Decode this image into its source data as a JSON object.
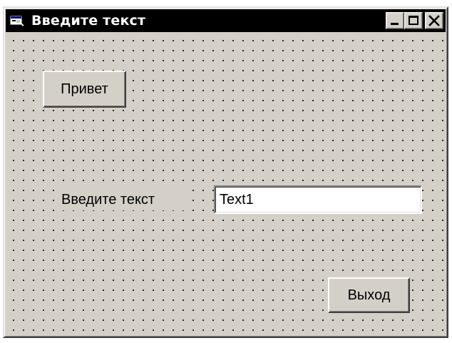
{
  "window": {
    "title": "Введите текст"
  },
  "form": {
    "hello_button_label": "Привет",
    "prompt_label": "Введите текст",
    "text_input_value": "Text1",
    "exit_button_label": "Выход"
  },
  "icons": {
    "app": "vb-form-icon",
    "minimize": "minimize-icon",
    "maximize": "maximize-icon",
    "close": "close-icon"
  },
  "colors": {
    "titlebar": "#000000",
    "title_text": "#ffffff",
    "form_background": "#d4d0c8",
    "textbox_background": "#ffffff",
    "grid_dots": "#000000"
  }
}
